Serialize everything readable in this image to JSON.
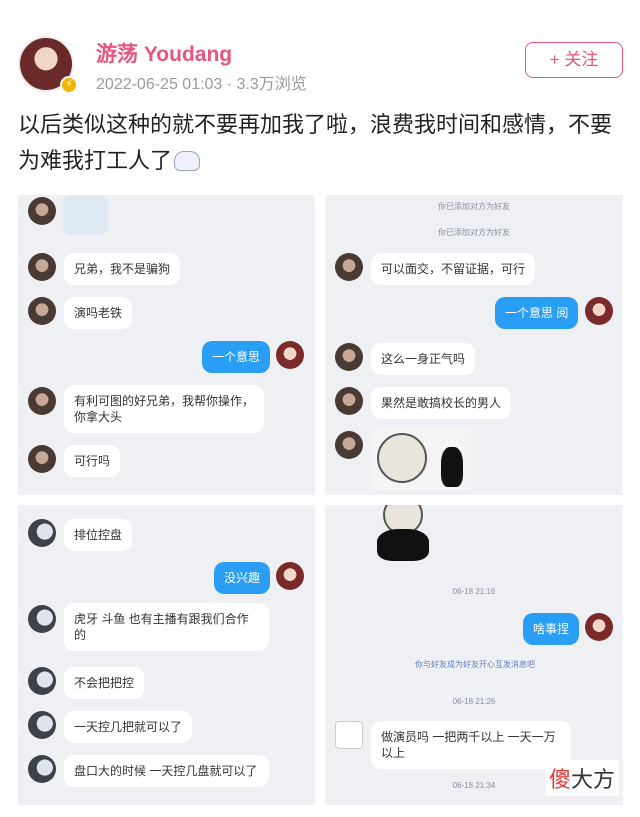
{
  "post": {
    "username": "游荡 Youdang",
    "meta": "2022-06-25 01:03 · 3.3万浏览",
    "follow_label": "+ 关注",
    "text": "以后类似这种的就不要再加我了啦，浪费我时间和感情，不要为难我打工人了"
  },
  "panel1": {
    "messages": [
      "兄弟，我不是骗狗",
      "演吗老铁",
      "一个意思",
      "有利可图的好兄弟，我帮你操作，你拿大头",
      "可行吗"
    ]
  },
  "panel2": {
    "system": [
      "你已添加对方为好友",
      "你已添加对方为好友"
    ],
    "messages": [
      "可以面交，不留证据，可行",
      "一个意思 阅",
      "这么一身正气吗",
      "果然是敢搞校长的男人"
    ]
  },
  "panel3": {
    "messages": [
      "排位控盘",
      "没兴趣",
      "虎牙 斗鱼 也有主播有跟我们合作的",
      "不会把把控",
      "一天控几把就可以了",
      "盘口大的时候 一天控几盘就可以了"
    ]
  },
  "panel4": {
    "times": [
      "06-18 21:16",
      "06-18 21:26",
      "06-18 21:34"
    ],
    "messages": [
      "啥事捏",
      "做演员吗 一把两千以上 一天一万以上"
    ],
    "system_link": "你与好友成为好友开心互发消息吧"
  },
  "watermark": {
    "accent": "傻",
    "rest": "大方"
  },
  "colors": {
    "accent_pink": "#e8557e",
    "bubble_blue": "#2a9df4"
  }
}
